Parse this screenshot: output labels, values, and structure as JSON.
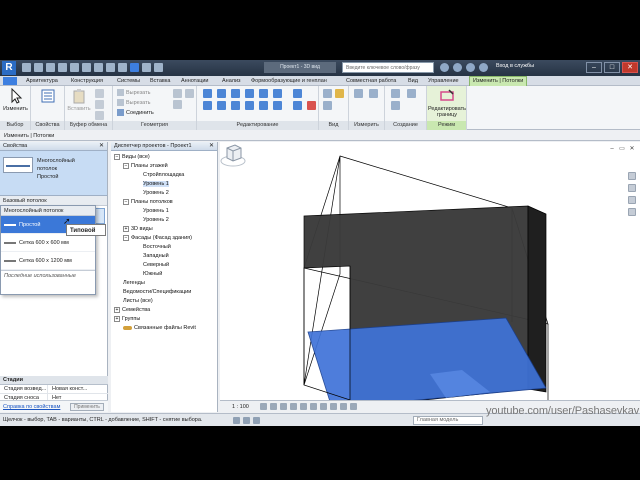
{
  "titlebar": {
    "logo": "R",
    "document_title": "Проект1 - 3D вид",
    "search_placeholder": "Введите ключевое слово/фразу",
    "login_label": "Вход в службы",
    "window_buttons": [
      "–",
      "□",
      "✕"
    ]
  },
  "tabs": [
    "Архитектура",
    "Конструкция",
    "Системы",
    "Вставка",
    "Аннотации",
    "Анализ",
    "Формообразующие и генплан",
    "Совместная работа",
    "Вид",
    "Управление",
    "Изменить | Потолки"
  ],
  "ribbon": {
    "groups": {
      "select": {
        "label": "Выбор",
        "modify": "Изменить"
      },
      "properties": {
        "label": "Свойства"
      },
      "clipboard": {
        "label": "Буфер обмена",
        "paste": "Вставить"
      },
      "geometry": {
        "label": "Геометрия",
        "items": [
          "Вырезать",
          "Вырезать",
          "Соединить"
        ]
      },
      "modify": {
        "label": "Редактирование"
      },
      "view": {
        "label": "Вид"
      },
      "measure": {
        "label": "Измерить"
      },
      "create": {
        "label": "Создание"
      },
      "mode": {
        "label": "Режим",
        "edit_boundary": "Редактировать границу"
      }
    }
  },
  "options_bar": {
    "text": "Изменить | Потолки"
  },
  "properties": {
    "title": "Свойства",
    "type_name": "Многослойный потолок",
    "type_sub": "Простой",
    "family_header": "Базовый потолок",
    "selected_type": "Типовой",
    "dropdown": {
      "header": "Многослойный потолок",
      "items": [
        "Простой",
        "Сетка 600 х 600 мм",
        "Сетка 600 х 1200 мм"
      ],
      "recent": "Последние использованные"
    },
    "tooltip": "Типовой",
    "stages": {
      "header": "Стадии",
      "rows": [
        {
          "name": "Стадия возвед...",
          "value": "Новая конст..."
        },
        {
          "name": "Стадия сноса",
          "value": "Нет"
        }
      ]
    },
    "help_link": "Справка по свойствам",
    "apply_button": "Применить"
  },
  "browser": {
    "title": "Диспетчер проектов - Проект1",
    "nodes": [
      {
        "label": "Виды (все)",
        "expander": "−"
      },
      {
        "label": "Планы этажей",
        "expander": "−"
      },
      {
        "label": "Стройплощадка",
        "expander": ""
      },
      {
        "label": "Уровень 1",
        "expander": ""
      },
      {
        "label": "Уровень 2",
        "expander": ""
      },
      {
        "label": "Планы потолков",
        "expander": "−"
      },
      {
        "label": "Уровень 1",
        "expander": ""
      },
      {
        "label": "Уровень 2",
        "expander": ""
      },
      {
        "label": "3D виды",
        "expander": "+"
      },
      {
        "label": "Фасады (Фасад здания)",
        "expander": "−"
      },
      {
        "label": "Восточный",
        "expander": ""
      },
      {
        "label": "Западный",
        "expander": ""
      },
      {
        "label": "Северный",
        "expander": ""
      },
      {
        "label": "Южный",
        "expander": ""
      },
      {
        "label": "Легенды",
        "expander": ""
      },
      {
        "label": "Ведомости/Спецификации",
        "expander": ""
      },
      {
        "label": "Листы (все)",
        "expander": ""
      },
      {
        "label": "Семейства",
        "expander": "+"
      },
      {
        "label": "Группы",
        "expander": "+"
      },
      {
        "label": "Связанные файлы Revit",
        "expander": ""
      }
    ]
  },
  "viewport": {
    "scale": "1 : 100",
    "model_field_placeholder": "Главная модель",
    "colors": {
      "wall": "#333333",
      "floor": "#3f73d8",
      "edge": "#000000"
    }
  },
  "statusbar": {
    "text": "Щелчок - выбор, TAB - варианты, CTRL - добавление, SHIFT - снятие выбора."
  },
  "watermark": "youtube.com/user/Pashasevkav"
}
